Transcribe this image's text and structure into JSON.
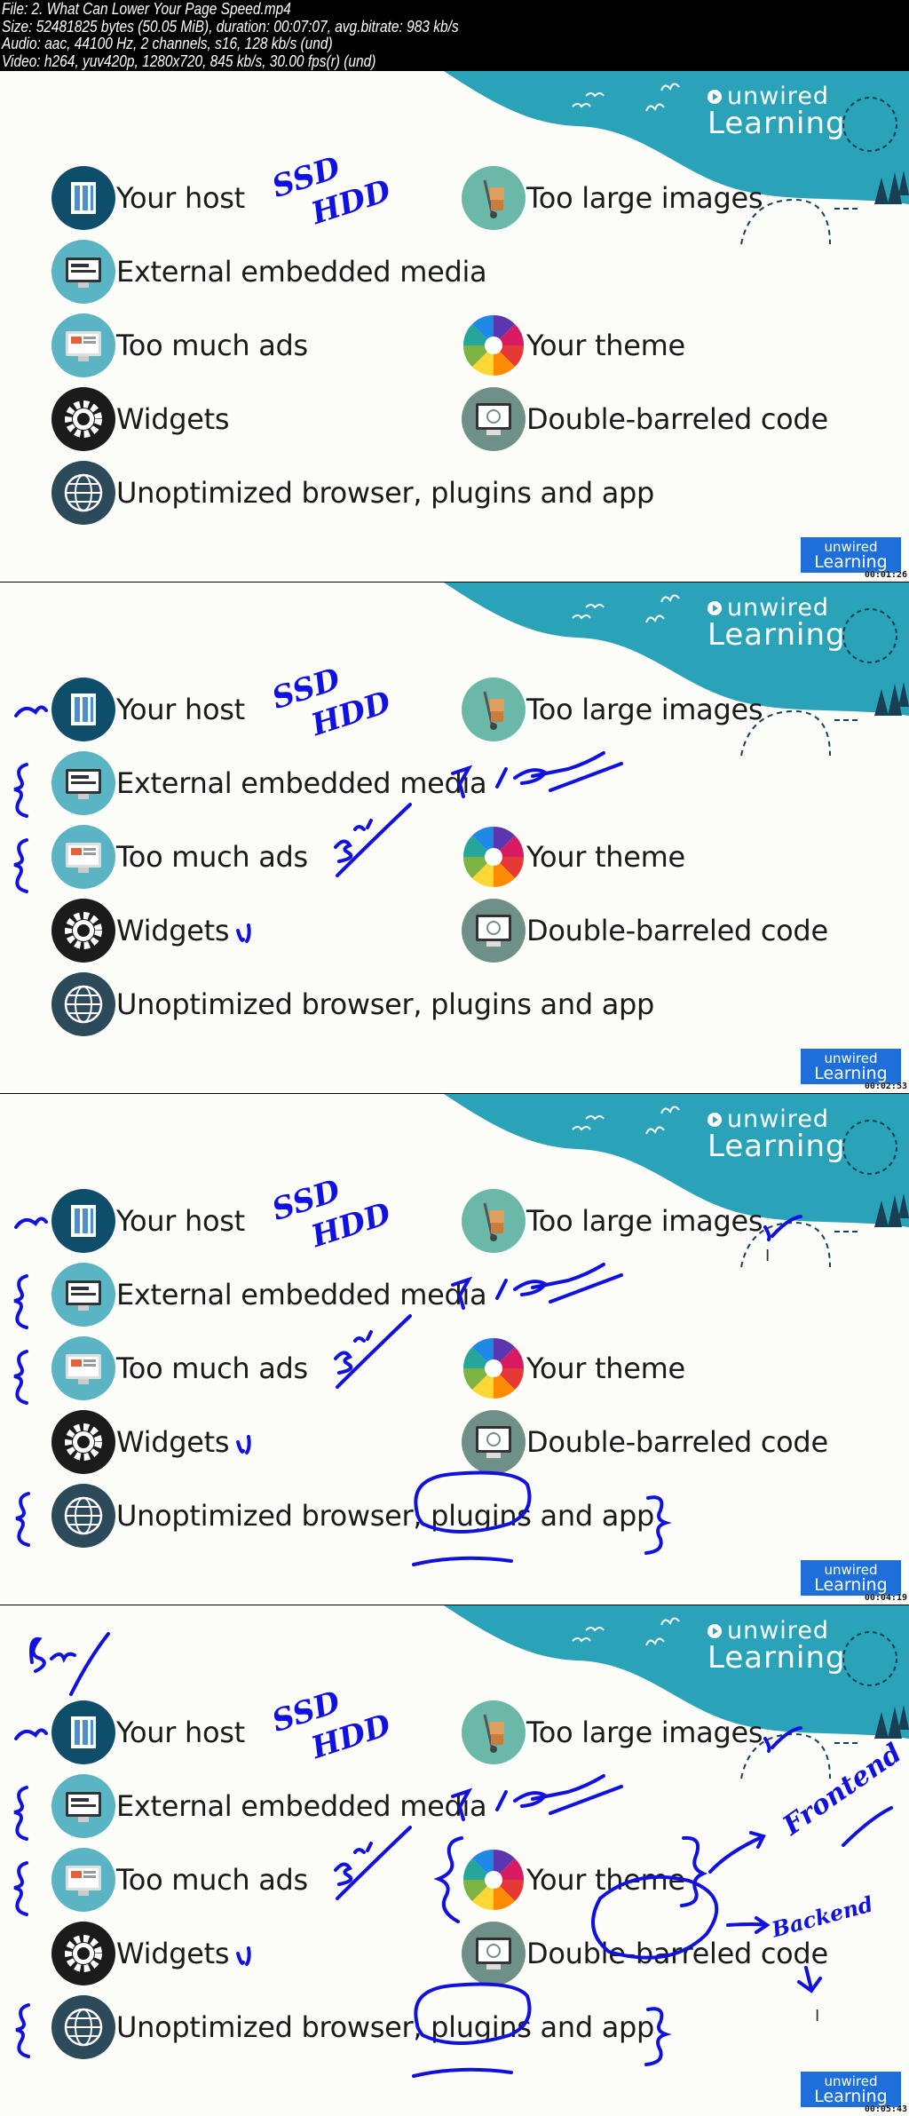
{
  "file_info": [
    "File: 2. What Can Lower Your Page Speed.mp4",
    "Size: 52481825 bytes (50.05 MiB), duration: 00:07:07, avg.bitrate: 983 kb/s",
    "Audio: aac, 44100 Hz, 2 channels, s16, 128 kb/s (und)",
    "Video: h264, yuv420p, 1280x720, 845 kb/s, 30.00 fps(r) (und)"
  ],
  "logo": {
    "line1": "unwired",
    "line2": "Learning"
  },
  "colors": {
    "teal": "#2aa3b9",
    "ink": "#1010e0",
    "badge": "#1e6fd9"
  },
  "items": [
    {
      "label": "Your host",
      "icon": "server-icon",
      "color": "#0f4e6b",
      "col": "left",
      "row": 0
    },
    {
      "label": "Too large images",
      "icon": "hand-truck-icon",
      "color": "#6cb8a8",
      "col": "right",
      "row": 0
    },
    {
      "label": "External embedded media",
      "icon": "monitor-media-icon",
      "color": "#5ab4c4",
      "col": "left",
      "row": 1
    },
    {
      "label": "Too much ads",
      "icon": "monitor-ads-icon",
      "color": "#5ab4c4",
      "col": "left",
      "row": 2
    },
    {
      "label": "Your theme",
      "icon": "color-wheel-icon",
      "color": "#e04a6a",
      "col": "right",
      "row": 2
    },
    {
      "label": "Widgets",
      "icon": "gear-icon",
      "color": "#1b1b1b",
      "col": "left",
      "row": 3
    },
    {
      "label": "Double-barreled code",
      "icon": "monitor-code-icon",
      "color": "#6f9088",
      "col": "right",
      "row": 3
    },
    {
      "label": "Unoptimized browser, plugins and app",
      "icon": "globe-icon",
      "color": "#2c4a5a",
      "col": "left",
      "row": 4
    }
  ],
  "handwriting": {
    "ssd": "SSD",
    "hdd": "HDD",
    "frontend": "Frontend",
    "backend": "Backend"
  },
  "frames": [
    {
      "timestamp": "00:01:26",
      "annotations": [
        "ssd-hdd"
      ]
    },
    {
      "timestamp": "00:02:53",
      "annotations": [
        "ssd-hdd",
        "set2"
      ]
    },
    {
      "timestamp": "00:04:19",
      "annotations": [
        "ssd-hdd",
        "set2",
        "set3"
      ]
    },
    {
      "timestamp": "00:05:43",
      "annotations": [
        "ssd-hdd",
        "set2",
        "set3",
        "set4"
      ]
    }
  ]
}
